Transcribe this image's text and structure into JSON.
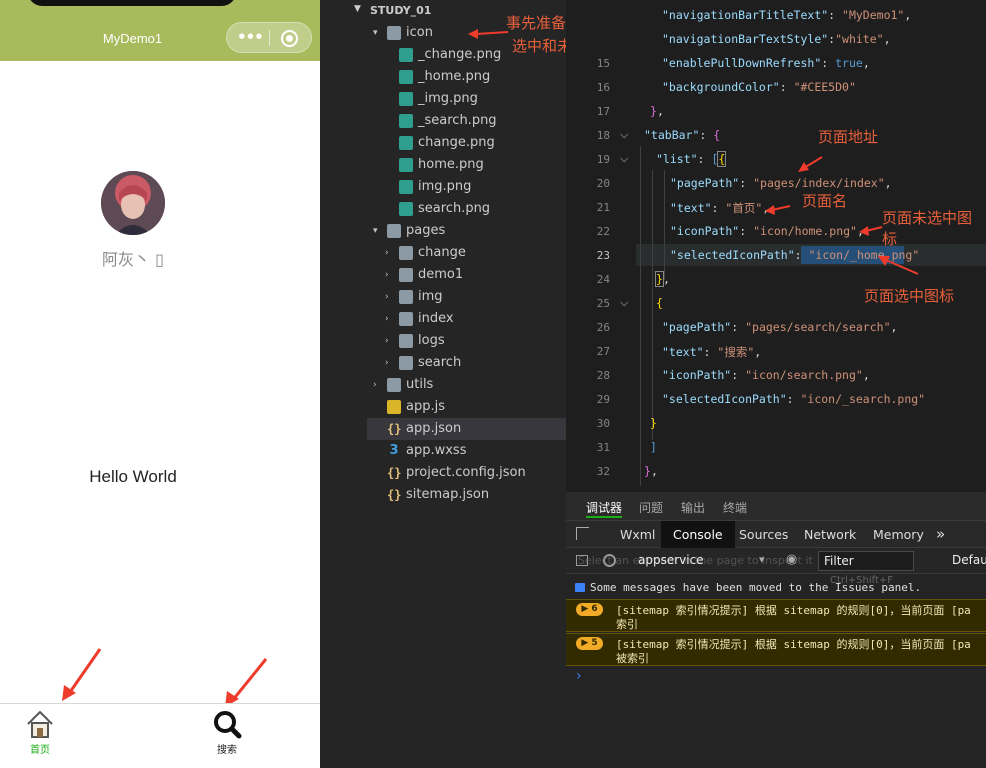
{
  "phone": {
    "nav_title": "MyDemo1",
    "nickname": "阿灰丶 ▯",
    "hello": "Hello World",
    "tabs": [
      {
        "label": "首页",
        "icon": "home-icon",
        "selected": true
      },
      {
        "label": "搜索",
        "icon": "search-icon",
        "selected": false
      }
    ],
    "colors": {
      "navbar": "#a9ba5d",
      "tab_selected": "#1aad19"
    }
  },
  "explorer": {
    "root": "STUDY_01",
    "items": [
      {
        "name": "icon",
        "type": "folder",
        "expanded": true
      },
      {
        "name": "_change.png",
        "type": "png"
      },
      {
        "name": "_home.png",
        "type": "png"
      },
      {
        "name": "_img.png",
        "type": "png"
      },
      {
        "name": "_search.png",
        "type": "png"
      },
      {
        "name": "change.png",
        "type": "png"
      },
      {
        "name": "home.png",
        "type": "png"
      },
      {
        "name": "img.png",
        "type": "png"
      },
      {
        "name": "search.png",
        "type": "png"
      },
      {
        "name": "pages",
        "type": "folder",
        "expanded": true
      },
      {
        "name": "change",
        "type": "folder"
      },
      {
        "name": "demo1",
        "type": "folder"
      },
      {
        "name": "img",
        "type": "folder"
      },
      {
        "name": "index",
        "type": "folder"
      },
      {
        "name": "logs",
        "type": "folder"
      },
      {
        "name": "search",
        "type": "folder"
      },
      {
        "name": "utils",
        "type": "folder"
      },
      {
        "name": "app.js",
        "type": "js"
      },
      {
        "name": "app.json",
        "type": "json",
        "selected": true
      },
      {
        "name": "app.wxss",
        "type": "css"
      },
      {
        "name": "project.config.json",
        "type": "json"
      },
      {
        "name": "sitemap.json",
        "type": "json"
      }
    ]
  },
  "annotations": {
    "icons_line1": "事先准备好的图标",
    "icons_line2": "选中和未选中状态",
    "page_path": "页面地址",
    "page_name": "页面名",
    "unselected_line1": "页面未选中图",
    "unselected_line2": "标",
    "selected_icon": "页面选中图标"
  },
  "editor": {
    "line_numbers": [
      "15",
      "16",
      "17",
      "18",
      "19",
      "20",
      "21",
      "22",
      "23",
      "24",
      "25",
      "26",
      "27",
      "28",
      "29",
      "30",
      "31",
      "32"
    ],
    "active_line": "23",
    "code": {
      "l14_key": "\"navigationBarTitleText\"",
      "l14_val": "\"MyDemo1\"",
      "l14b_key": "\"navigationBarTextStyle\"",
      "l14b_val": "\"white\"",
      "l15_key": "\"enablePullDownRefresh\"",
      "l15_val": "true",
      "l16_key": "\"backgroundColor\"",
      "l16_val": "\"#CEE5D0\"",
      "l18_key": "\"tabBar\"",
      "l19_key": "\"list\"",
      "l20_key": "\"pagePath\"",
      "l20_val": "\"pages/index/index\"",
      "l21_key": "\"text\"",
      "l21_val": "\"首页\"",
      "l22_key": "\"iconPath\"",
      "l22_val": "\"icon/home.png\"",
      "l23_key": "\"selectedIconPath\"",
      "l23_val": "\"icon/_home.png\"",
      "l26_key": "\"pagePath\"",
      "l26_val": "\"pages/search/search\"",
      "l27_key": "\"text\"",
      "l27_val": "\"搜索\"",
      "l28_key": "\"iconPath\"",
      "l28_val": "\"icon/search.png\"",
      "l29_key": "\"selectedIconPath\"",
      "l29_val": "\"icon/_search.png\""
    }
  },
  "devtools": {
    "top_tabs": [
      "调试器",
      "问题",
      "输出",
      "终端"
    ],
    "panel_tabs": [
      "Wxml",
      "Console",
      "Sources",
      "Network",
      "Memory"
    ],
    "more": "»",
    "context": "appservice",
    "filter_placeholder": "Filter",
    "filter_hint": "Ctrl+Shift+F",
    "levels": "Defaul",
    "inspect_hint": "Select an element in the page to inspect it",
    "info_message": "Some messages have been moved to the Issues panel.",
    "warnings": [
      {
        "count": "6",
        "line1": "[sitemap 索引情况提示] 根据 sitemap 的规则[0]，当前页面 [pa",
        "line2": "索引"
      },
      {
        "count": "5",
        "line1": "[sitemap 索引情况提示] 根据 sitemap 的规则[0]，当前页面 [pa",
        "line2": "被索引"
      }
    ],
    "prompt": "›"
  }
}
